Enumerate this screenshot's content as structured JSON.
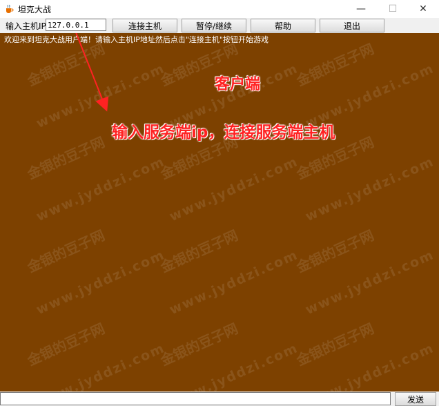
{
  "window": {
    "title": "坦克大战",
    "minimize_glyph": "—",
    "maximize_glyph": "☐",
    "close_glyph": "✕",
    "icon": "java-cup-icon"
  },
  "toolbar": {
    "ip_label": "输入主机IP",
    "ip_value": "127.0.0.1",
    "connect_label": "连接主机",
    "pause_label": "暂停/继续",
    "help_label": "帮助",
    "exit_label": "退出"
  },
  "game": {
    "background_color": "#7d4100",
    "welcome_text": "欢迎来到坦克大战用户端！请输入主机IP地址然后点击\"连接主机\"按钮开始游戏",
    "watermark_cn": "金银的豆子网",
    "watermark_en": "www.jyddzi.com"
  },
  "annotations": {
    "role": "客户端",
    "hint": "输入服务端ip，连接服务端主机",
    "color": "#ff2222"
  },
  "bottom": {
    "chat_value": "",
    "send_label": "发送"
  }
}
